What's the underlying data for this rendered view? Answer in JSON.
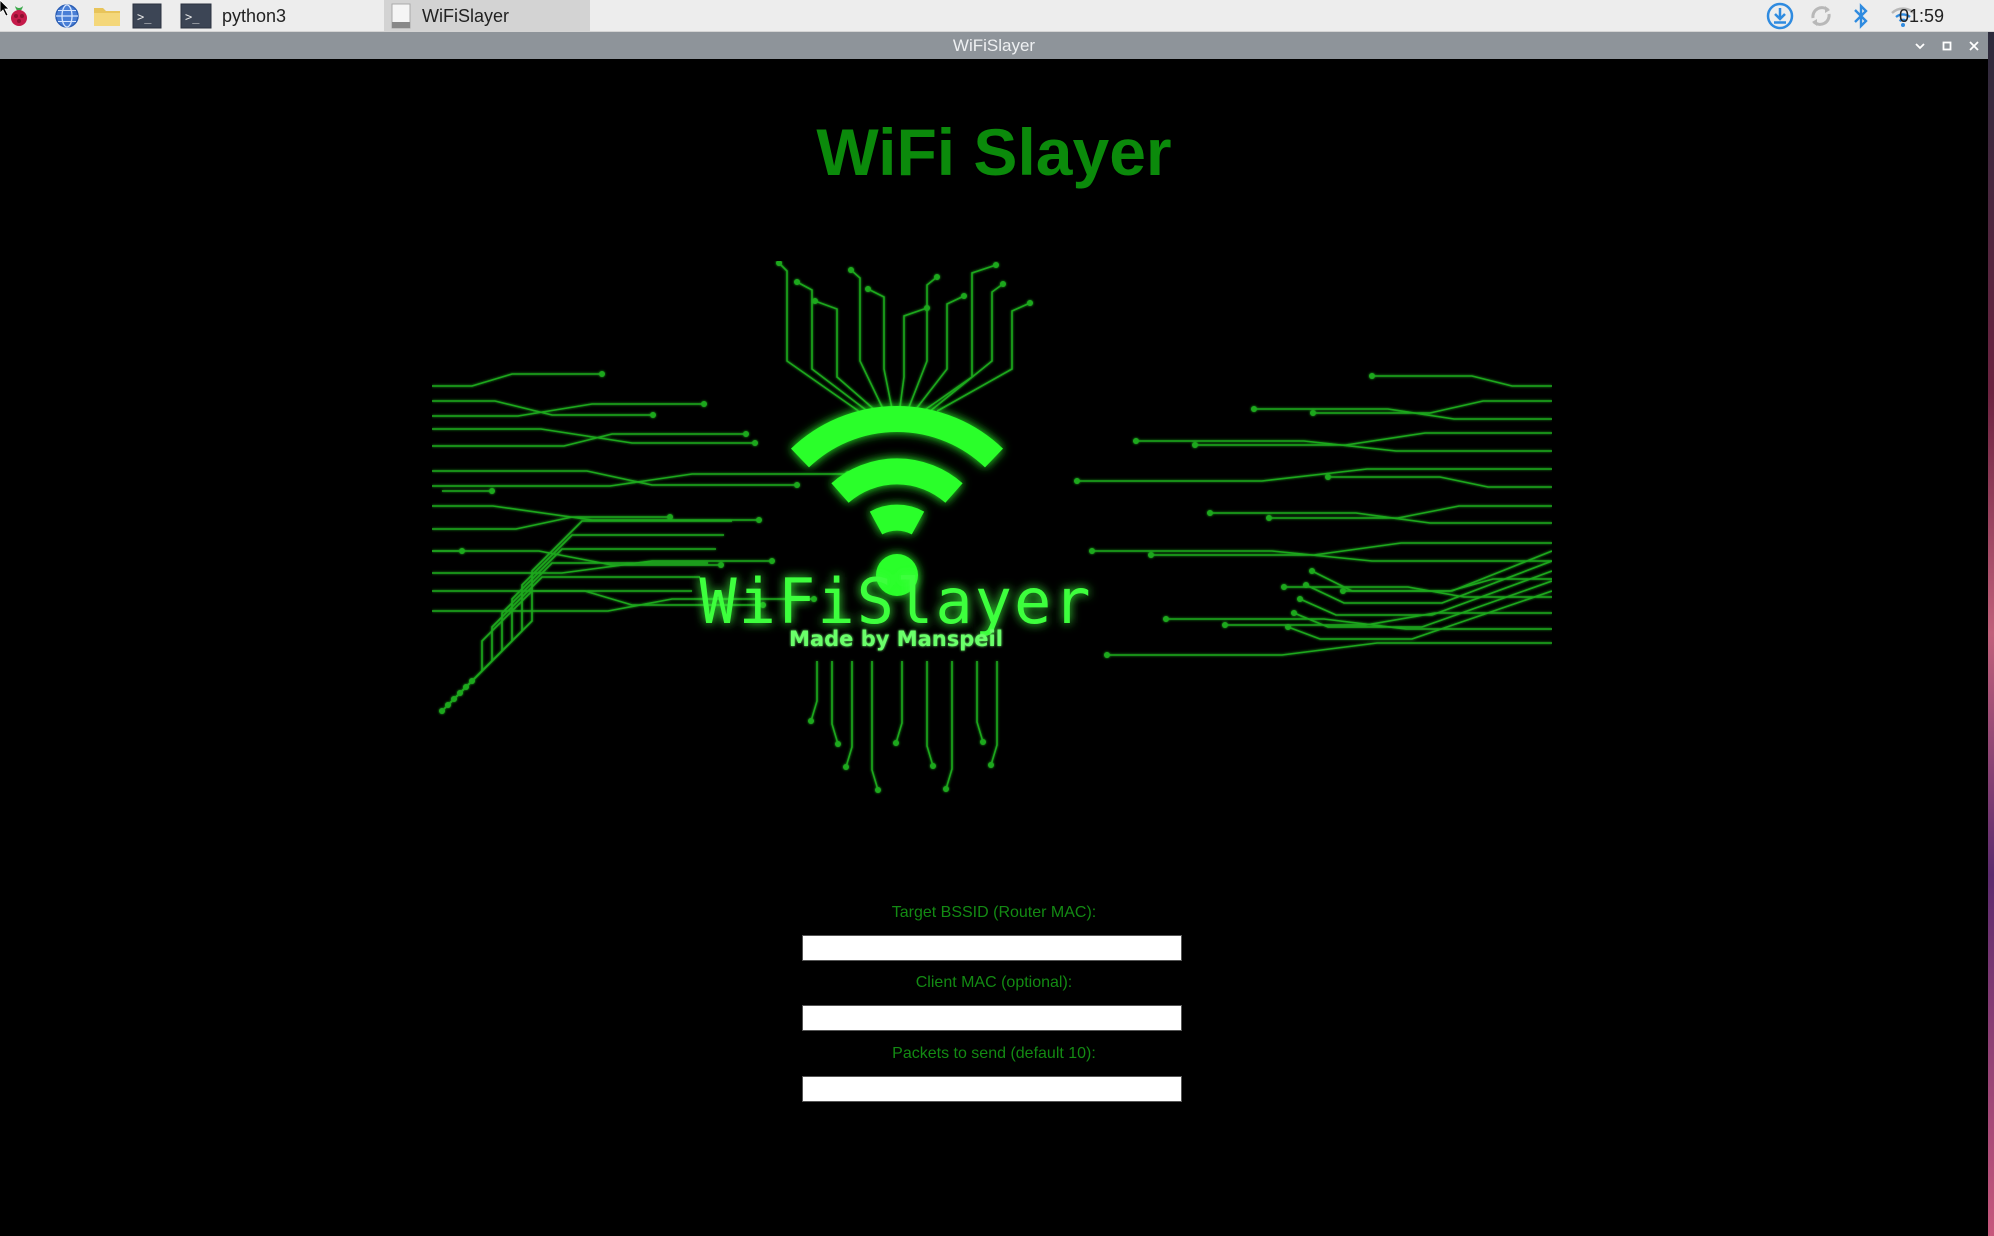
{
  "taskbar": {
    "tasks": [
      {
        "label": "python3",
        "active": false
      },
      {
        "label": "WiFiSlayer",
        "active": true
      }
    ],
    "clock": "01:59",
    "launchers": [
      "raspberry-menu-icon",
      "web-browser-icon",
      "file-manager-icon",
      "terminal-icon"
    ],
    "tray": [
      "download-icon",
      "sync-icon",
      "bluetooth-icon",
      "wifi-icon"
    ]
  },
  "window": {
    "title": "WiFiSlayer",
    "controls": [
      "minimize",
      "maximize",
      "close"
    ]
  },
  "app": {
    "heading": "WiFi Slayer",
    "banner": {
      "logo_text": "WiFiSlayer",
      "tagline": "Made by Manspeil"
    },
    "fields": [
      {
        "label": "Target BSSID (Router MAC):",
        "value": "",
        "placeholder": ""
      },
      {
        "label": "Client MAC (optional):",
        "value": "",
        "placeholder": ""
      },
      {
        "label": "Packets to send (default 10):",
        "value": "",
        "placeholder": ""
      }
    ]
  },
  "colors": {
    "background": "#000000",
    "heading": "#0b8a0b",
    "label": "#138a13",
    "neon": "#2bff2b",
    "circuit": "#1fa81f"
  }
}
